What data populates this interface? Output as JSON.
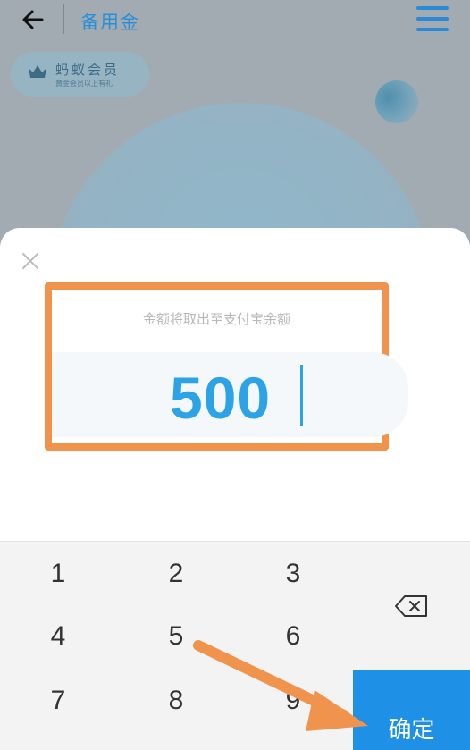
{
  "header": {
    "title": "备用金"
  },
  "member_badge": {
    "title": "蚂蚁会员",
    "subtitle": "黄金会员以上有礼"
  },
  "withdraw_sheet": {
    "hint": "金额将取出至支付宝余额",
    "amount": "500"
  },
  "keypad": {
    "keys": [
      "1",
      "2",
      "3",
      "4",
      "5",
      "6",
      "7",
      "8",
      "9"
    ],
    "confirm_label": "确定"
  },
  "colors": {
    "accent": "#2BA3E6",
    "confirm": "#1E90E6",
    "highlight": "#F0934C"
  },
  "icons": [
    "back-arrow-icon",
    "menu-icon",
    "crown-icon",
    "close-icon",
    "backspace-icon"
  ]
}
